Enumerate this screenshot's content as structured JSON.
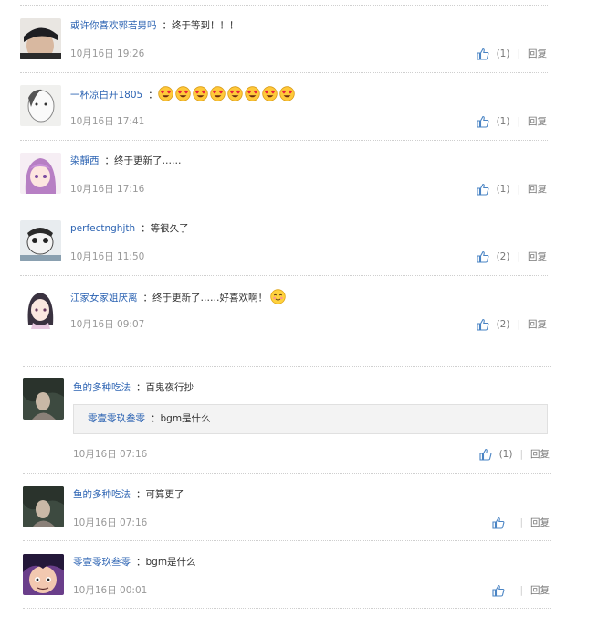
{
  "comments": [
    {
      "user": "或许你喜欢郭若男吗",
      "colon": "：",
      "text": "终于等到！！！",
      "time": "10月16日 19:26",
      "likes": "(1)",
      "reply": "回复"
    },
    {
      "user": "一杯凉白开1805",
      "colon": "：",
      "text": "",
      "time": "10月16日 17:41",
      "likes": "(1)",
      "reply": "回复",
      "emoji_count": 8,
      "emoji_name": "heart-eyes-emoji"
    },
    {
      "user": "染靜西",
      "colon": "：",
      "text": "终于更新了……",
      "time": "10月16日 17:16",
      "likes": "(1)",
      "reply": "回复"
    },
    {
      "user": "perfectnghjth",
      "colon": "：",
      "text": "等很久了",
      "time": "10月16日 11:50",
      "likes": "(2)",
      "reply": "回复"
    },
    {
      "user": "江家女家姐厌离",
      "colon": "：",
      "text": "终于更新了……好喜欢啊！",
      "time": "10月16日 09:07",
      "likes": "(2)",
      "reply": "回复",
      "emoji_name": "blush-emoji"
    }
  ],
  "comments2": [
    {
      "user": "鱼的多种吃法",
      "colon": "：",
      "text": "百鬼夜行抄",
      "time": "10月16日 07:16",
      "likes": "(1)",
      "reply": "回复",
      "quote": {
        "user": "零壹零玖叁零",
        "colon": "：",
        "text": "bgm是什么"
      }
    },
    {
      "user": "鱼的多种吃法",
      "colon": "：",
      "text": "可算更了",
      "time": "10月16日 07:16",
      "likes": "",
      "reply": "回复"
    },
    {
      "user": "零壹零玖叁零",
      "colon": "：",
      "text": "bgm是什么",
      "time": "10月16日 00:01",
      "likes": "",
      "reply": "回复"
    }
  ],
  "divider": "|",
  "colors": {
    "link": "#2d64b3",
    "meta": "#999999",
    "like_icon": "#4a84c4"
  }
}
